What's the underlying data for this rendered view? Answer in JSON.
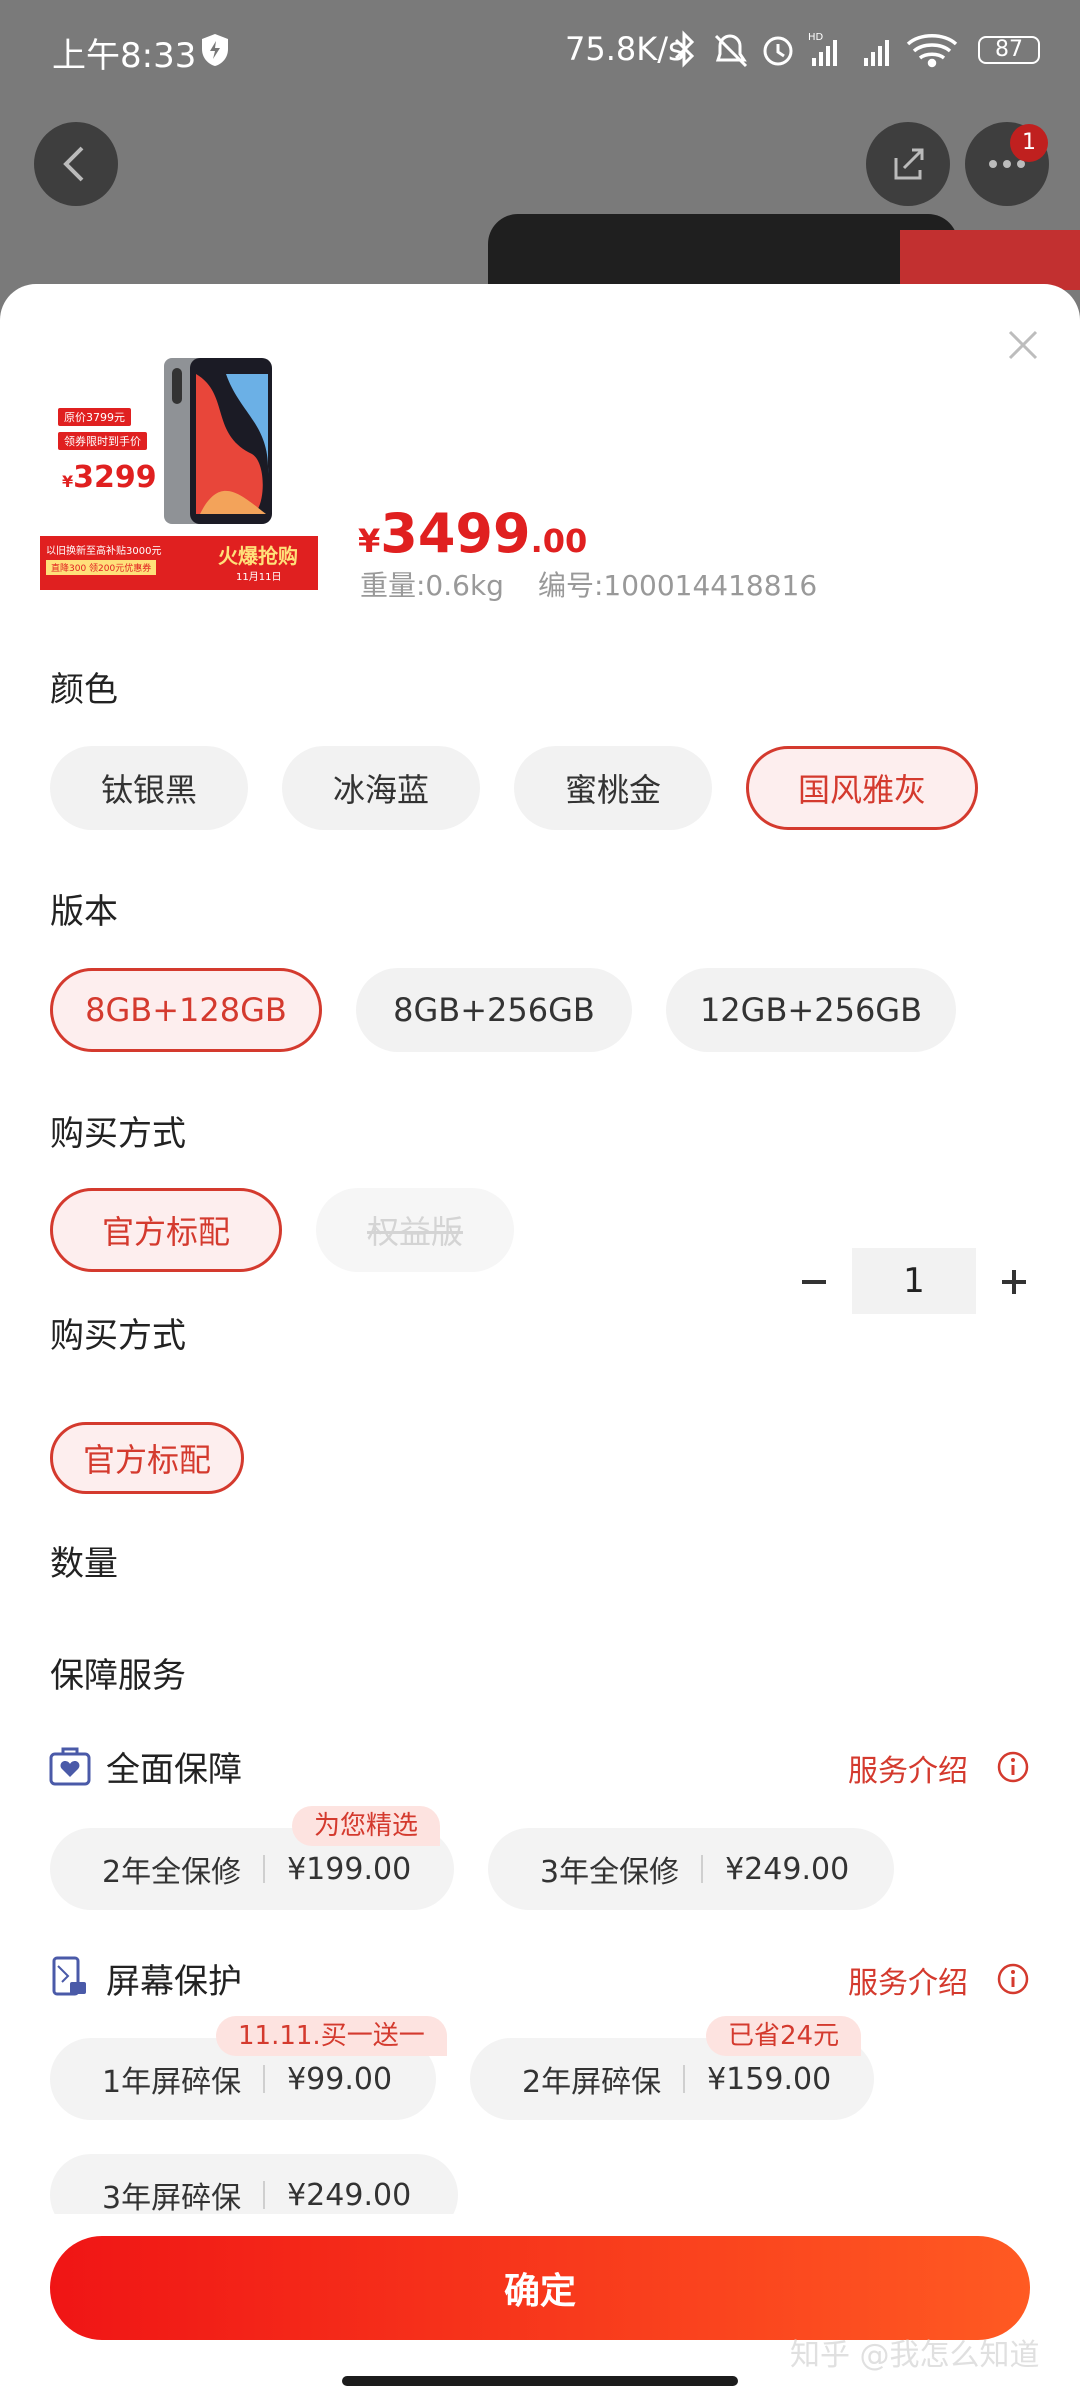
{
  "status_bar": {
    "time": "上午8:33",
    "net_speed": "75.8K/s",
    "battery": "87",
    "icons": [
      "shield-icon",
      "bluetooth-icon",
      "mute-icon",
      "alarm-icon",
      "signal-hd-icon",
      "signal-icon",
      "wifi-icon",
      "battery-icon"
    ]
  },
  "background": {
    "more_badge": "1"
  },
  "product": {
    "thumb": {
      "original_price": "原价3799元",
      "coupon_text": "领券限时到手价",
      "promo_price": "3299",
      "promo_currency": "¥",
      "trade_in": "以旧换新至高补贴3000元",
      "coupon_line": "直降300 领200元优惠券",
      "banner": "火爆抢购",
      "date": "11月11日"
    },
    "currency": "¥",
    "price_int": "3499",
    "price_dec": ".00",
    "weight": "重量:0.6kg",
    "sku": "编号:100014418816"
  },
  "color": {
    "title": "颜色",
    "options": [
      "钛银黑",
      "冰海蓝",
      "蜜桃金",
      "国风雅灰"
    ],
    "selected": "国风雅灰"
  },
  "version": {
    "title": "版本",
    "options": [
      "8GB+128GB",
      "8GB+256GB",
      "12GB+256GB"
    ],
    "selected": "8GB+128GB"
  },
  "buy_method_1": {
    "title": "购买方式",
    "options": [
      "官方标配",
      "权益版"
    ],
    "selected": "官方标配",
    "disabled": "权益版"
  },
  "buy_method_2": {
    "title": "购买方式",
    "options": [
      "官方标配"
    ],
    "selected": "官方标配"
  },
  "quantity": {
    "title": "数量",
    "value": "1",
    "minus": "−",
    "plus": "+"
  },
  "guarantee": {
    "title": "保障服务",
    "full": {
      "title": "全面保障",
      "link": "服务介绍",
      "options": [
        {
          "name": "2年全保修",
          "price": "¥199.00",
          "tag": "为您精选"
        },
        {
          "name": "3年全保修",
          "price": "¥249.00",
          "tag": ""
        }
      ]
    },
    "screen": {
      "title": "屏幕保护",
      "link": "服务介绍",
      "options": [
        {
          "name": "1年屏碎保",
          "price": "¥99.00",
          "tag": "11.11.买一送一"
        },
        {
          "name": "2年屏碎保",
          "price": "¥159.00",
          "tag": "已省24元"
        },
        {
          "name": "3年屏碎保",
          "price": "¥249.00",
          "tag": ""
        }
      ]
    }
  },
  "confirm_label": "确定",
  "watermark": "知乎 @我怎么知道",
  "colors": {
    "accent": "#d43a2e",
    "price": "#e02020",
    "chip_bg": "#f2f2f2"
  }
}
